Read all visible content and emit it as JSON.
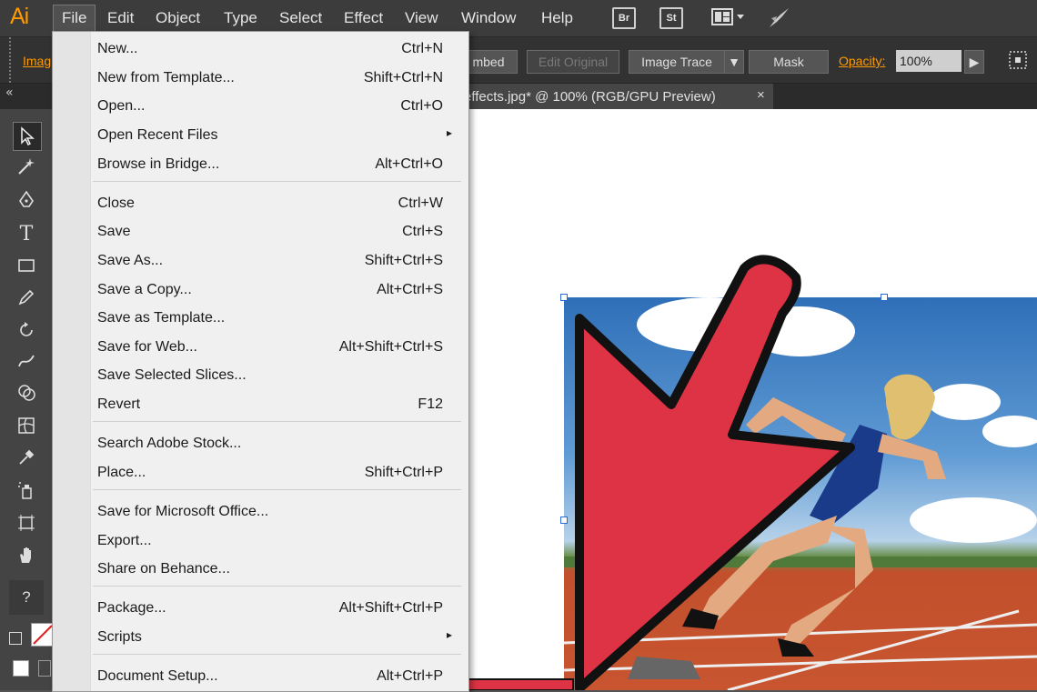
{
  "app": {
    "logo": "Ai"
  },
  "menubar": {
    "items": [
      "File",
      "Edit",
      "Object",
      "Type",
      "Select",
      "Effect",
      "View",
      "Window",
      "Help"
    ],
    "bridge_label": "Br",
    "stock_label": "St"
  },
  "controlbar": {
    "image_label": "Imag",
    "embed_label": "mbed",
    "edit_original_label": "Edit Original",
    "image_trace_label": "Image Trace",
    "mask_label": "Mask",
    "opacity_label": "Opacity:",
    "opacity_value": "100%"
  },
  "document_tab": {
    "title": "effects.jpg* @ 100% (RGB/GPU Preview)",
    "close": "×"
  },
  "file_menu": {
    "items": [
      {
        "label": "New...",
        "shortcut": "Ctrl+N"
      },
      {
        "label": "New from Template...",
        "shortcut": "Shift+Ctrl+N"
      },
      {
        "label": "Open...",
        "shortcut": "Ctrl+O"
      },
      {
        "label": "Open Recent Files",
        "shortcut": "",
        "submenu": true
      },
      {
        "label": "Browse in Bridge...",
        "shortcut": "Alt+Ctrl+O"
      },
      {
        "label": "Close",
        "shortcut": "Ctrl+W"
      },
      {
        "label": "Save",
        "shortcut": "Ctrl+S"
      },
      {
        "label": "Save As...",
        "shortcut": "Shift+Ctrl+S"
      },
      {
        "label": "Save a Copy...",
        "shortcut": "Alt+Ctrl+S"
      },
      {
        "label": "Save as Template...",
        "shortcut": ""
      },
      {
        "label": "Save for Web...",
        "shortcut": "Alt+Shift+Ctrl+S"
      },
      {
        "label": "Save Selected Slices...",
        "shortcut": ""
      },
      {
        "label": "Revert",
        "shortcut": "F12"
      },
      {
        "label": "Search Adobe Stock...",
        "shortcut": ""
      },
      {
        "label": "Place...",
        "shortcut": "Shift+Ctrl+P"
      },
      {
        "label": "Save for Microsoft Office...",
        "shortcut": ""
      },
      {
        "label": "Export...",
        "shortcut": ""
      },
      {
        "label": "Share on Behance...",
        "shortcut": ""
      },
      {
        "label": "Package...",
        "shortcut": "Alt+Shift+Ctrl+P"
      },
      {
        "label": "Scripts",
        "shortcut": "",
        "submenu": true
      },
      {
        "label": "Document Setup...",
        "shortcut": "Alt+Ctrl+P"
      }
    ]
  },
  "toolbar": {
    "collapse": "«",
    "help": "?"
  },
  "colors": {
    "accent": "#ff9a00",
    "arrow": "#dd3344"
  }
}
